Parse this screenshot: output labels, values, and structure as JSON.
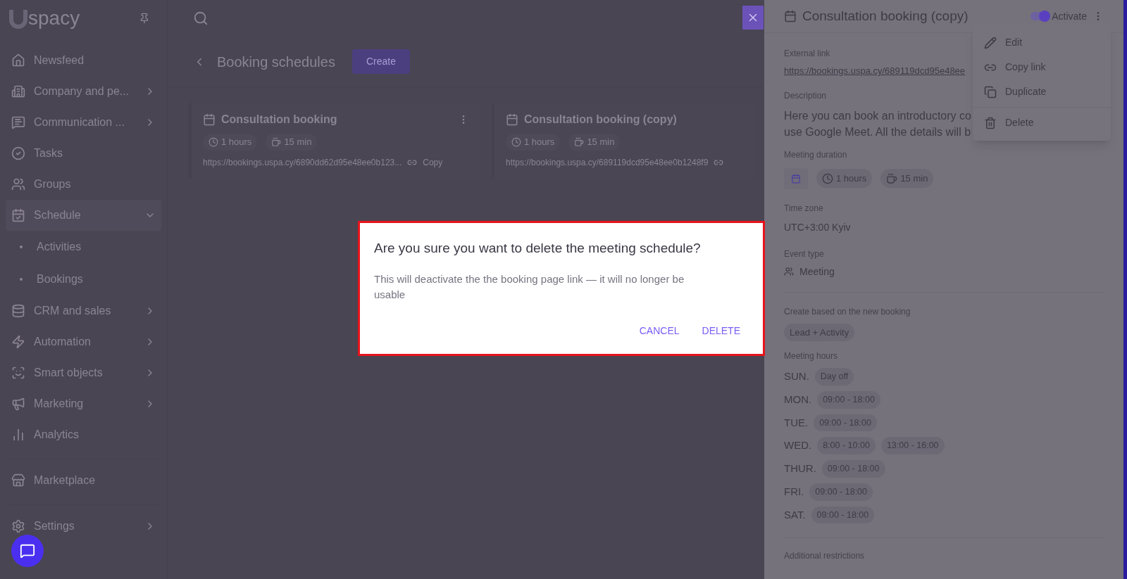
{
  "logo": {
    "text": "spacy"
  },
  "sidebar": {
    "items": [
      {
        "kind": "link",
        "label": "Newsfeed"
      },
      {
        "kind": "group",
        "label": "Company and pe...",
        "expanded": false
      },
      {
        "kind": "group",
        "label": "Communication ...",
        "expanded": false
      },
      {
        "kind": "link",
        "label": "Tasks"
      },
      {
        "kind": "link",
        "label": "Groups"
      },
      {
        "kind": "group",
        "label": "Schedule",
        "expanded": true,
        "children": [
          {
            "label": "Activities"
          },
          {
            "label": "Bookings"
          }
        ]
      },
      {
        "kind": "group",
        "label": "CRM and sales",
        "expanded": false
      },
      {
        "kind": "group",
        "label": "Automation",
        "expanded": false
      },
      {
        "kind": "group",
        "label": "Smart objects",
        "expanded": false
      },
      {
        "kind": "group",
        "label": "Marketing",
        "expanded": false
      },
      {
        "kind": "link",
        "label": "Analytics"
      },
      {
        "kind": "link",
        "label": "Marketplace"
      },
      {
        "kind": "group",
        "label": "Settings",
        "expanded": false
      }
    ]
  },
  "page": {
    "title": "Booking schedules",
    "create_button": "Create",
    "cards": [
      {
        "title": "Consultation booking",
        "duration": "1 hours",
        "break": "15 min",
        "link": "https://bookings.uspa.cy/6890dd62d95e48ee0b123...",
        "copy": "Copy"
      },
      {
        "title": "Consultation booking (copy)",
        "duration": "1 hours",
        "break": "15 min",
        "link": "https://bookings.uspa.cy/689119dcd95e48ee0b1248f9"
      }
    ]
  },
  "dialog": {
    "title": "Are you sure you want to delete the meeting schedule?",
    "message": "This will deactivate the the booking page link — it will no longer be usable",
    "buttons": [
      "CANCEL",
      "DELETE"
    ]
  },
  "panel": {
    "title": "Consultation booking (copy)",
    "activate": {
      "label": "Activate",
      "on": true
    },
    "external_link_label": "External link",
    "external_link": "https://bookings.uspa.cy/689119dcd95e48ee",
    "description_label": "Description",
    "description": [
      "Here you can book an introductory co",
      "use Google Meet. All the details will b"
    ],
    "duration_label": "Meeting duration",
    "duration": "1 hours",
    "break": "15 min",
    "time_zone_label": "Time zone",
    "time_zone": "UTC+3:00 Kyiv",
    "event_type_label": "Event type",
    "event_type": "Meeting",
    "create_label": "Create based on the new booking",
    "create_value": "Lead + Activity",
    "hours_label": "Meeting hours",
    "days": [
      {
        "day": "SUN.",
        "slots": [
          "Day off"
        ]
      },
      {
        "day": "MON.",
        "slots": [
          "09:00 - 18:00"
        ]
      },
      {
        "day": "TUE.",
        "slots": [
          "09:00 - 18:00"
        ]
      },
      {
        "day": "WED.",
        "slots": [
          "8:00 - 10:00",
          "13:00 - 16:00"
        ]
      },
      {
        "day": "THUR.",
        "slots": [
          "09:00 - 18:00"
        ]
      },
      {
        "day": "FRI.",
        "slots": [
          "09:00 - 18:00"
        ]
      },
      {
        "day": "SAT.",
        "slots": [
          "09:00 - 18:00"
        ]
      }
    ],
    "restrictions_label": "Additional restrictions"
  },
  "menu": {
    "items": [
      {
        "label": "Edit",
        "divider_before": false
      },
      {
        "label": "Copy link",
        "divider_before": false
      },
      {
        "label": "Duplicate",
        "divider_before": false
      },
      {
        "label": "Delete",
        "divider_before": true
      }
    ]
  }
}
